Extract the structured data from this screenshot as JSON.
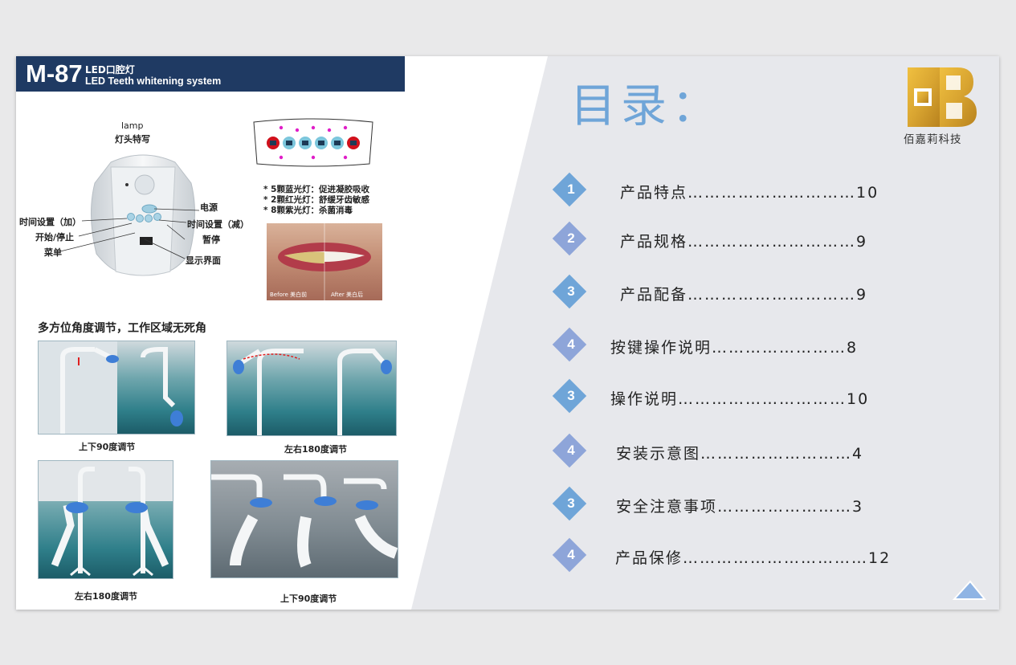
{
  "sheet": {
    "model": "M-87",
    "product_cn": "LED口腔灯",
    "product_en": "LED Teeth whitening system",
    "lamp_title": "lamp",
    "lamp_subtitle": "灯头特写",
    "callouts": {
      "power": "电源",
      "time_add": "时间设置（加）",
      "time_sub": "时间设置（减）",
      "start_stop": "开始/停止",
      "pause": "暂停",
      "menu": "菜单",
      "display": "显示界面"
    },
    "led_notes": [
      "* 5颗蓝光灯：促进凝胶吸收",
      "* 2颗红光灯：舒缓牙齿敏感",
      "* 8颗紫光灯：杀菌消毒"
    ],
    "photo_before": "Before 美白前",
    "photo_after": "After 美白后",
    "angle_title": "多方位角度调节，工作区域无死角",
    "captions": [
      "上下90度调节",
      "左右180度调节",
      "左右180度调节",
      "上下90度调节"
    ]
  },
  "toc": {
    "title": "目录：",
    "company": "佰嘉莉科技",
    "items": [
      {
        "num": "1",
        "text": "产品特点…………………………10",
        "color": "#6fa5d8"
      },
      {
        "num": "2",
        "text": "产品规格…………………………9",
        "color": "#8ea5d9"
      },
      {
        "num": "3",
        "text": "产品配备…………………………9",
        "color": "#6fa5d8"
      },
      {
        "num": "4",
        "text": "按键操作说明……………………8",
        "color": "#8ea5d9"
      },
      {
        "num": "3",
        "text": "操作说明…………………………10",
        "color": "#6fa5d8"
      },
      {
        "num": "4",
        "text": "安装示意图………………………4",
        "color": "#8ea5d9"
      },
      {
        "num": "3",
        "text": "安全注意事项……………………3",
        "color": "#6fa5d8"
      },
      {
        "num": "4",
        "text": "产品保修……………………………12",
        "color": "#8ea5d9"
      }
    ]
  },
  "colors": {
    "header": "#1f3a63",
    "accent_blue": "#6fa5d8",
    "accent_purple": "#8ea5d9",
    "logo_gold": "#d9a531"
  }
}
